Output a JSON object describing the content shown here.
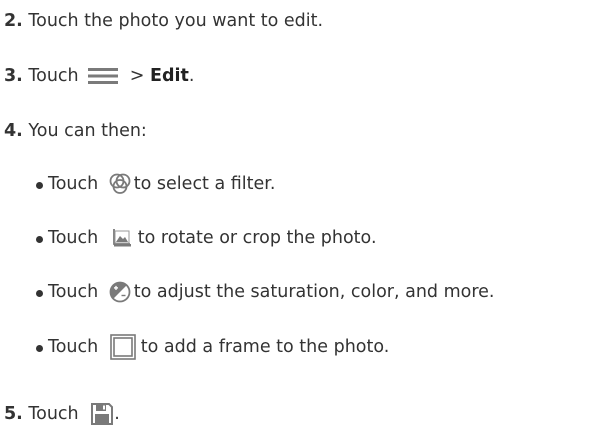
{
  "steps": [
    {
      "number": "2.",
      "text": " Touch the photo you want to edit."
    },
    {
      "number": "3.",
      "pre": " Touch ",
      "post": " > ",
      "bold": "Edit",
      "end": "."
    },
    {
      "number": "4.",
      "text": " You can then:"
    },
    {
      "number": "5.",
      "pre": " Touch ",
      "end": " ."
    }
  ],
  "bullets": [
    {
      "pre": "Touch ",
      "post": "to select a filter.",
      "icon": "filter-icon"
    },
    {
      "pre": "Touch ",
      "post": "to rotate or crop the photo.",
      "icon": "image-crop-icon"
    },
    {
      "pre": "Touch ",
      "post": "to adjust the saturation, color, and more.",
      "icon": "adjust-icon"
    },
    {
      "pre": "Touch ",
      "post": "to add a frame to the photo.",
      "icon": "frame-icon"
    }
  ],
  "icons": {
    "menu": "menu-icon",
    "save": "save-icon"
  },
  "colors": {
    "text": "#333333",
    "icon": "#7a7a7a"
  }
}
